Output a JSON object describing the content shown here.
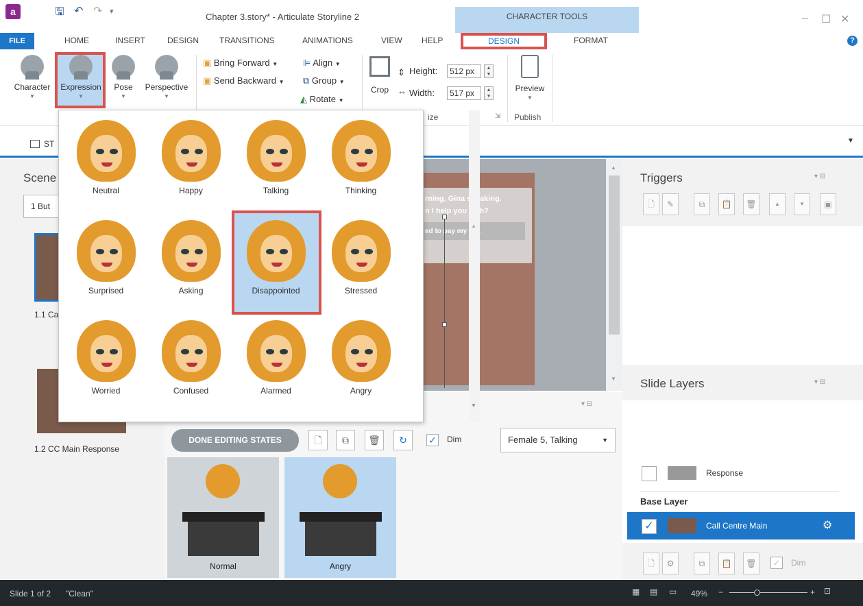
{
  "window": {
    "title": "Chapter 3.story* - Articulate Storyline 2",
    "contextual_group": "CHARACTER TOOLS"
  },
  "tabs": [
    "FILE",
    "HOME",
    "INSERT",
    "DESIGN",
    "TRANSITIONS",
    "ANIMATIONS",
    "VIEW",
    "HELP",
    "DESIGN",
    "FORMAT"
  ],
  "ribbon": {
    "character": "Character",
    "expression": "Expression",
    "pose": "Pose",
    "perspective": "Perspective",
    "bring_forward": "Bring Forward",
    "send_backward": "Send Backward",
    "align": "Align",
    "group": "Group",
    "rotate": "Rotate",
    "crop": "Crop",
    "height_label": "Height:",
    "height_value": "512 px",
    "width_label": "Width:",
    "width_value": "517 px",
    "size_group": "ize",
    "preview": "Preview",
    "publish_group": "Publish"
  },
  "story_tab_partial": "ST",
  "scenes": {
    "title_partial": "Scene",
    "dropdown_partial": "1 But",
    "slide1_partial": "1.1 Ca",
    "slide2": "1.2 CC Main Response"
  },
  "canvas": {
    "callout_line1": "rning, Gina speaking.",
    "callout_line2": "n I help you with?",
    "callout_choice": "ed to pay my bill."
  },
  "expressions": [
    "Neutral",
    "Happy",
    "Talking",
    "Thinking",
    "Surprised",
    "Asking",
    "Disappointed",
    "Stressed",
    "Worried",
    "Confused",
    "Alarmed",
    "Angry"
  ],
  "states_panel": {
    "done_button": "DONE EDITING STATES",
    "dim": "Dim",
    "character_select": "Female 5, Talking",
    "states": [
      "Normal",
      "Angry"
    ]
  },
  "triggers": {
    "title": "Triggers"
  },
  "slide_layers": {
    "title": "Slide Layers",
    "layers": [
      "Response"
    ],
    "base_layer_label": "Base Layer",
    "base_layer": "Call Centre Main",
    "dim": "Dim"
  },
  "status": {
    "slide": "Slide 1 of 2",
    "theme": "\"Clean\"",
    "zoom": "49%"
  },
  "colors": {
    "accent": "#1e76c8",
    "highlight": "#d9534f",
    "contextual": "#b9d7f1"
  }
}
